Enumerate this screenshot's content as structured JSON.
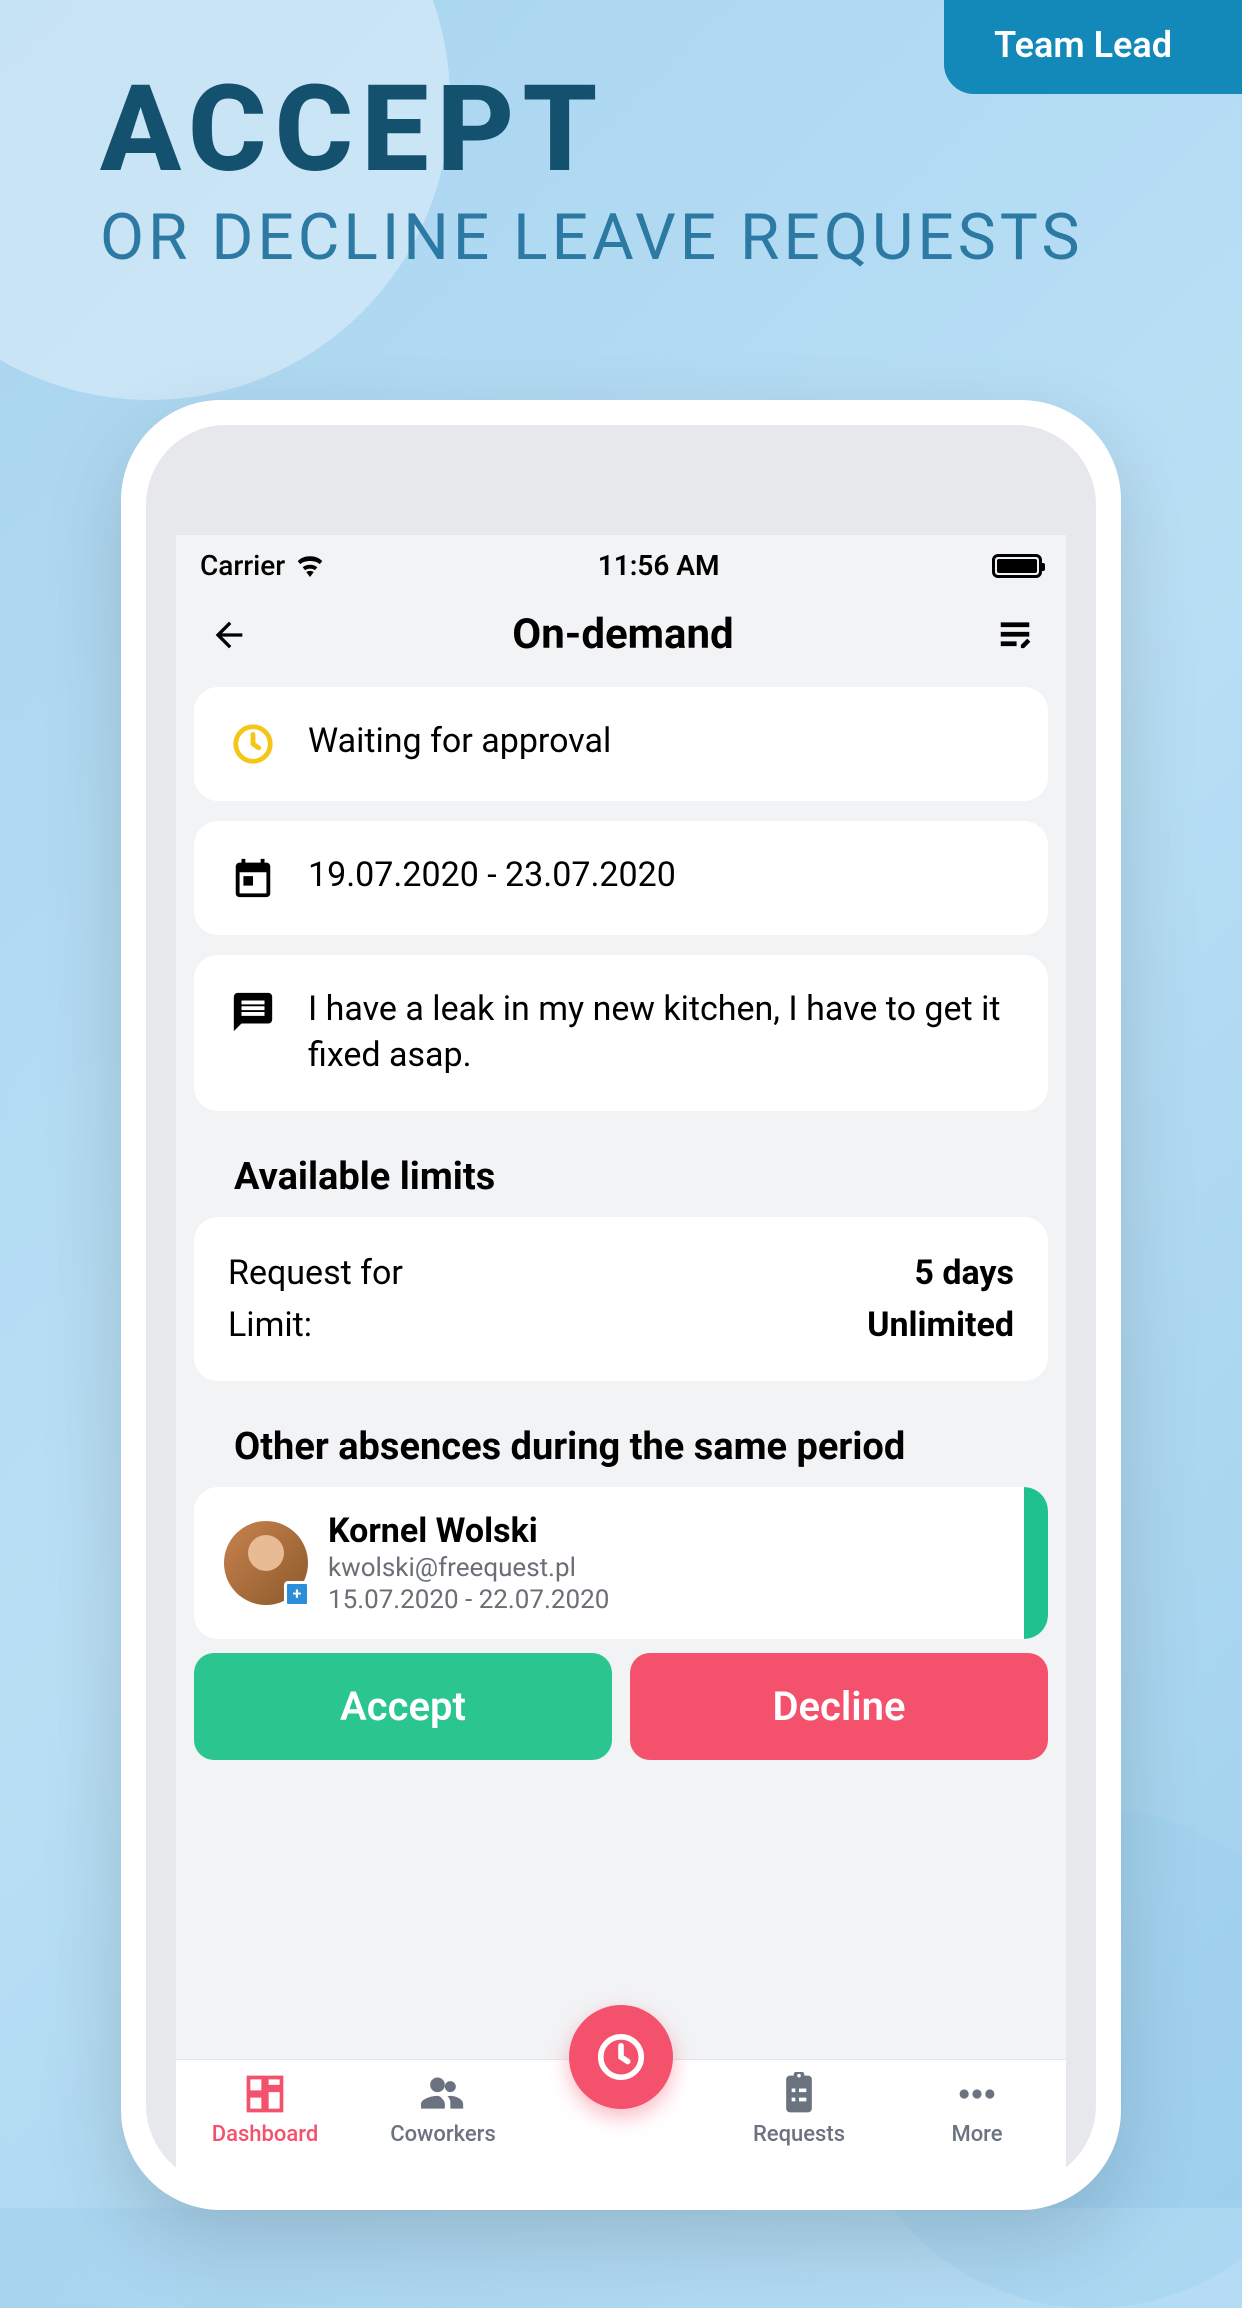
{
  "promo": {
    "role_badge": "Team Lead",
    "headline_primary": "ACCEPT",
    "headline_secondary": "OR DECLINE LEAVE REQUESTS"
  },
  "status_bar": {
    "carrier": "Carrier",
    "time": "11:56 AM"
  },
  "header": {
    "title": "On-demand"
  },
  "status_card": {
    "text": "Waiting for approval"
  },
  "date_card": {
    "text": "19.07.2020 - 23.07.2020"
  },
  "reason_card": {
    "text": "I have a leak in my new kitchen, I have to get it fixed asap."
  },
  "limits": {
    "title": "Available limits",
    "request_label": "Request for",
    "request_value": "5 days",
    "limit_label": "Limit:",
    "limit_value": "Unlimited"
  },
  "absences": {
    "title": "Other absences during the same period",
    "items": [
      {
        "name": "Kornel Wolski",
        "email": "kwolski@freequest.pl",
        "dates": "15.07.2020 - 22.07.2020"
      }
    ]
  },
  "actions": {
    "accept": "Accept",
    "decline": "Decline"
  },
  "tabs": {
    "dashboard": "Dashboard",
    "coworkers": "Coworkers",
    "requests": "Requests",
    "more": "More"
  }
}
